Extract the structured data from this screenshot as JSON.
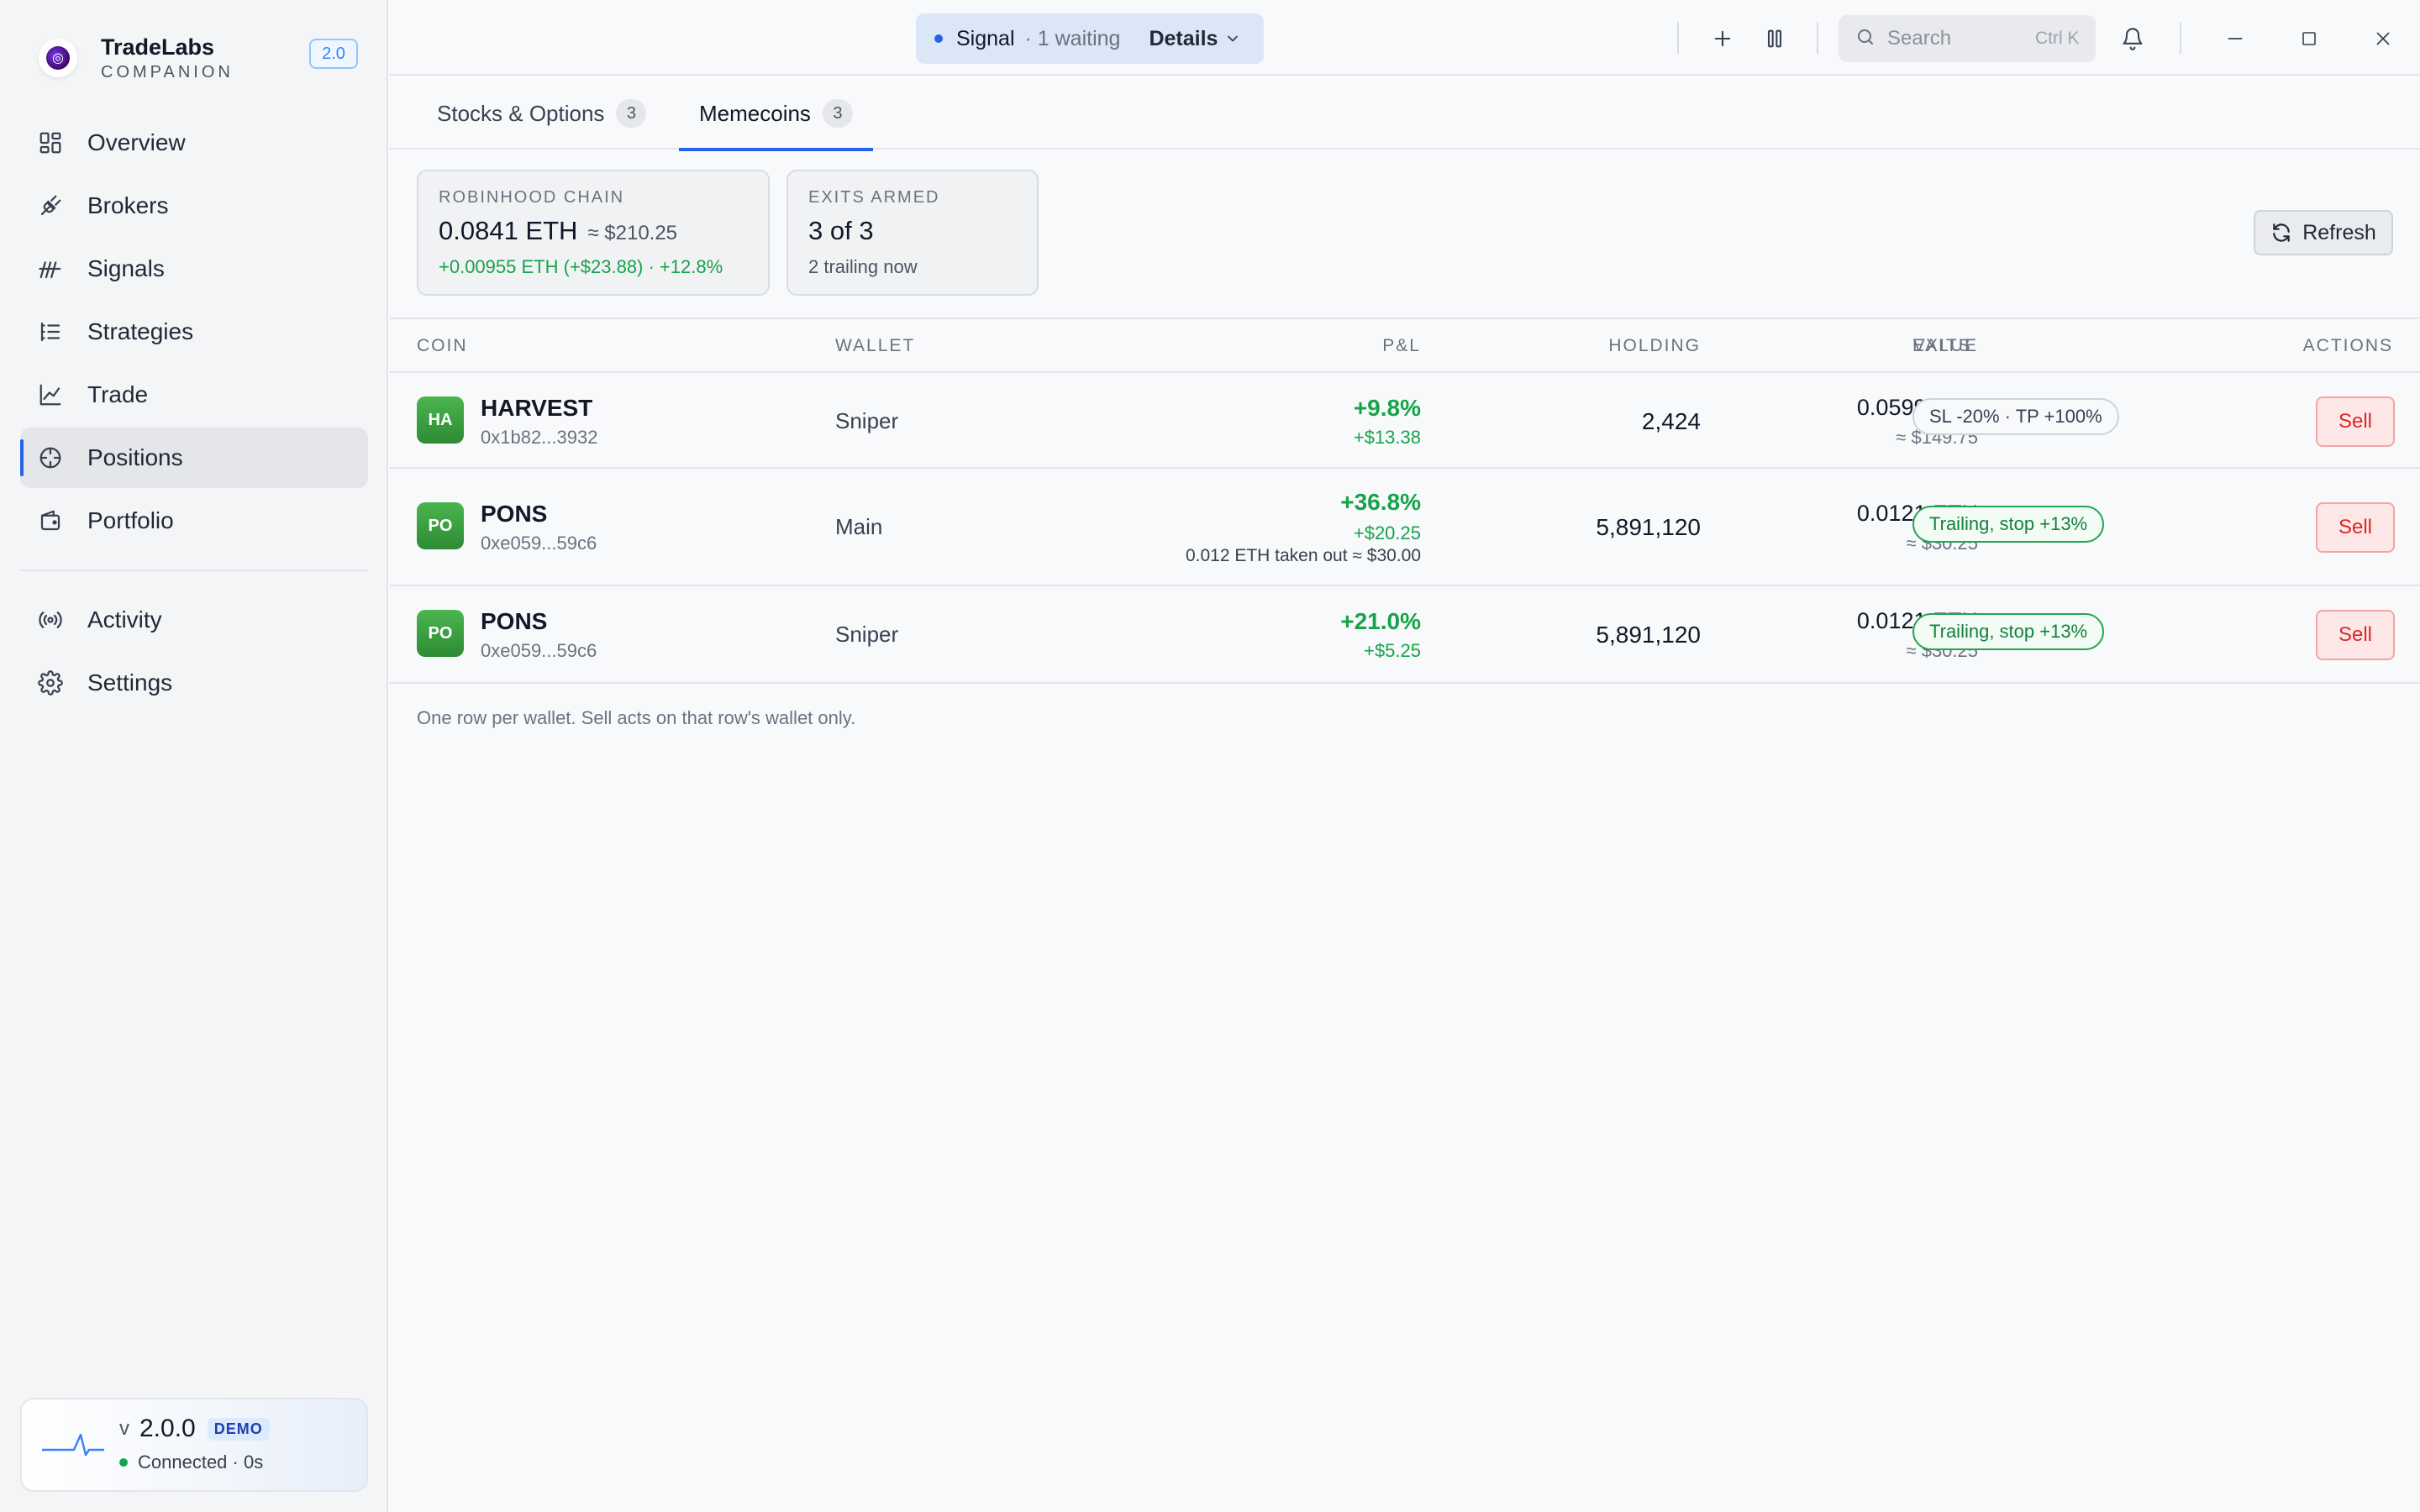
{
  "app": {
    "name": "TradeLabs",
    "subtitle": "COMPANION",
    "version_badge": "2.0"
  },
  "sidebar": {
    "items": [
      {
        "label": "Overview",
        "icon": "grid-icon"
      },
      {
        "label": "Brokers",
        "icon": "plug-icon"
      },
      {
        "label": "Signals",
        "icon": "signal-icon"
      },
      {
        "label": "Strategies",
        "icon": "list-icon"
      },
      {
        "label": "Trade",
        "icon": "chart-line-icon"
      },
      {
        "label": "Positions",
        "icon": "crosshair-icon",
        "active": true
      },
      {
        "label": "Portfolio",
        "icon": "wallet-icon"
      }
    ],
    "secondary_items": [
      {
        "label": "Activity",
        "icon": "broadcast-icon"
      },
      {
        "label": "Settings",
        "icon": "gear-icon"
      }
    ],
    "connection": {
      "v_prefix": "v",
      "version": "2.0.0",
      "badge": "DEMO",
      "status": "Connected · 0s",
      "status_color": "#16a34a"
    }
  },
  "topbar": {
    "signal": {
      "label": "Signal",
      "waiting": "· 1 waiting",
      "details": "Details"
    },
    "search": {
      "placeholder": "Search",
      "shortcut": "Ctrl K"
    }
  },
  "tabs": [
    {
      "label": "Stocks & Options",
      "count": "3"
    },
    {
      "label": "Memecoins",
      "count": "3",
      "active": true
    }
  ],
  "summary": {
    "chain": {
      "title": "ROBINHOOD CHAIN",
      "value": "0.0841 ETH",
      "approx": "≈ $210.25",
      "change": "+0.00955 ETH (+$23.88) · +12.8%"
    },
    "exits": {
      "title": "EXITS ARMED",
      "value": "3 of 3",
      "sub": "2 trailing now"
    },
    "refresh_label": "Refresh"
  },
  "table": {
    "headers": {
      "coin": "COIN",
      "wallet": "WALLET",
      "holding": "HOLDING",
      "value": "VALUE",
      "pnl": "P&L",
      "exits": "EXITS",
      "actions": "ACTIONS"
    },
    "rows": [
      {
        "avatar": "HA",
        "name": "HARVEST",
        "address": "0x1b82...3932",
        "wallet": "Sniper",
        "holding": "2,424",
        "value_eth": "0.0599 ETH",
        "value_usd": "≈ $149.75",
        "pnl_pct": "+9.8%",
        "pnl_usd": "+$13.38",
        "pnl_note": "",
        "exit": "SL -20% · TP +100%",
        "exit_style": "neutral",
        "action": "Sell"
      },
      {
        "avatar": "PO",
        "name": "PONS",
        "address": "0xe059...59c6",
        "wallet": "Main",
        "holding": "5,891,120",
        "value_eth": "0.0121 ETH",
        "value_usd": "≈ $30.25",
        "pnl_pct": "+36.8%",
        "pnl_usd": "+$20.25",
        "pnl_note": "0.012 ETH taken out ≈ $30.00",
        "exit": "Trailing, stop +13%",
        "exit_style": "green",
        "action": "Sell"
      },
      {
        "avatar": "PO",
        "name": "PONS",
        "address": "0xe059...59c6",
        "wallet": "Sniper",
        "holding": "5,891,120",
        "value_eth": "0.0121 ETH",
        "value_usd": "≈ $30.25",
        "pnl_pct": "+21.0%",
        "pnl_usd": "+$5.25",
        "pnl_note": "",
        "exit": "Trailing, stop +13%",
        "exit_style": "green",
        "action": "Sell"
      }
    ],
    "footnote": "One row per wallet. Sell acts on that row's wallet only."
  },
  "colors": {
    "accent": "#2563eb",
    "positive": "#16a34a",
    "danger": "#dc2626",
    "coin_avatar": "#3ca043"
  }
}
